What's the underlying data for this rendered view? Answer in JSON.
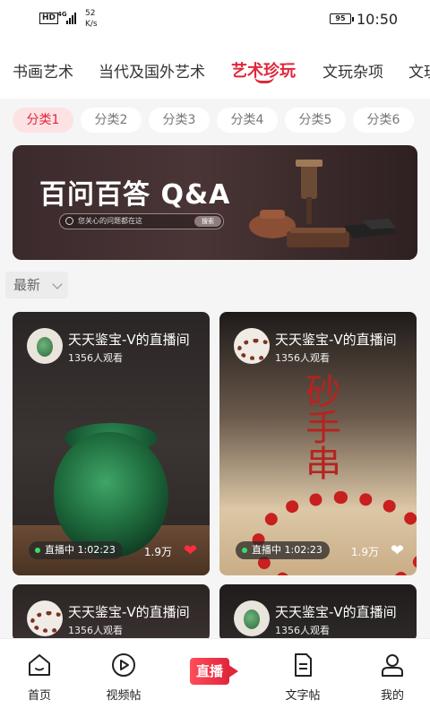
{
  "status_bar": {
    "hd": "HD",
    "network": "4G",
    "speed_value": "52",
    "speed_unit": "K/s",
    "battery": "95",
    "time": "10:50"
  },
  "category_tabs": [
    {
      "label": "书画艺术",
      "active": false
    },
    {
      "label": "当代及国外艺术",
      "active": false
    },
    {
      "label": "艺术珍玩",
      "active": true
    },
    {
      "label": "文玩杂项",
      "active": false
    },
    {
      "label": "文玩",
      "active": false
    }
  ],
  "sub_chips": [
    {
      "label": "分类1",
      "active": true
    },
    {
      "label": "分类2",
      "active": false
    },
    {
      "label": "分类3",
      "active": false
    },
    {
      "label": "分类4",
      "active": false
    },
    {
      "label": "分类5",
      "active": false
    },
    {
      "label": "分类6",
      "active": false
    }
  ],
  "banner": {
    "title": "百问百答 Q&A",
    "search_placeholder": "您关心的问题都在这",
    "search_button": "搜索"
  },
  "sort": {
    "label": "最新"
  },
  "cards": [
    {
      "title": "天天鉴宝-V的直播间",
      "viewers": "1356人观看",
      "live_status": "直播中",
      "duration": "1:02:23",
      "likes": "1.9万",
      "liked": true
    },
    {
      "title": "天天鉴宝-V的直播间",
      "viewers": "1356人观看",
      "live_status": "直播中",
      "duration": "1:02:23",
      "likes": "1.9万",
      "liked": false,
      "artwork_text": "砂手串"
    },
    {
      "title": "天天鉴宝-V的直播间",
      "viewers": "1356人观看"
    },
    {
      "title": "天天鉴宝-V的直播间",
      "viewers": "1356人观看"
    }
  ],
  "bottom_nav": [
    {
      "label": "首页",
      "icon": "home-icon"
    },
    {
      "label": "视频帖",
      "icon": "play-circle-icon"
    },
    {
      "label": "直播",
      "icon": "live-icon"
    },
    {
      "label": "文字帖",
      "icon": "document-icon"
    },
    {
      "label": "我的",
      "icon": "person-icon"
    }
  ],
  "colors": {
    "accent": "#e0263a",
    "chip_active_bg": "#fde2e4",
    "live_dot": "#3ddc6a"
  }
}
